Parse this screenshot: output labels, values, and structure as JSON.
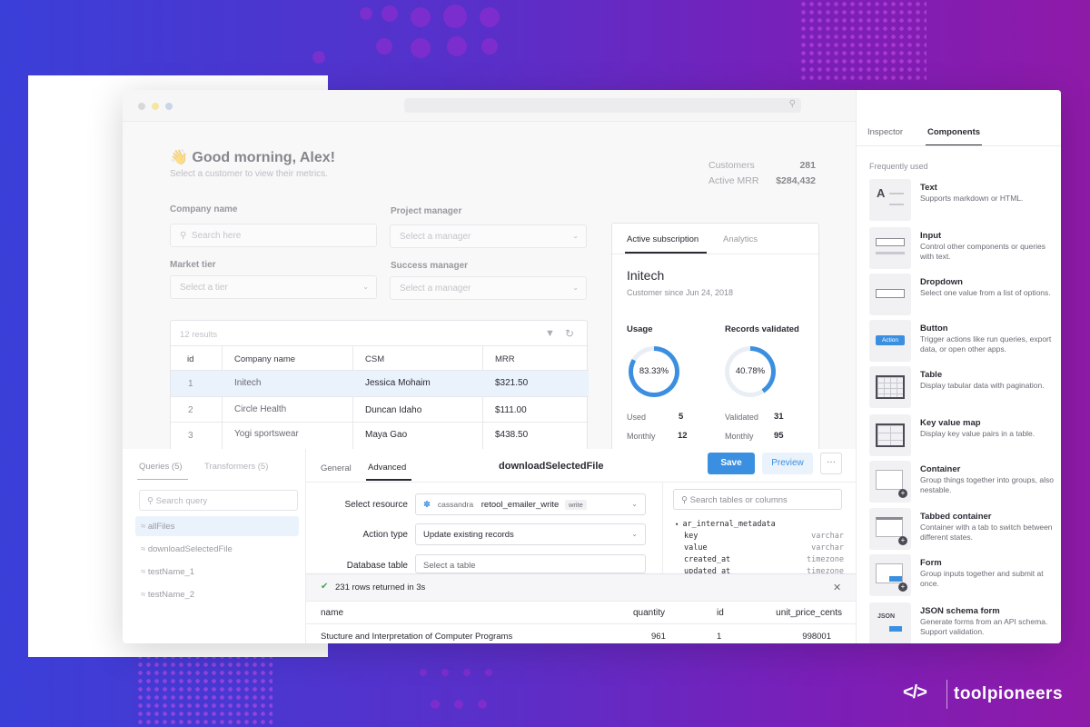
{
  "dashboard": {
    "greeting": "👋 Good morning, Alex!",
    "subtitle": "Select a customer to view their metrics.",
    "metrics": [
      {
        "label": "Customers",
        "value": "281"
      },
      {
        "label": "Active MRR",
        "value": "$284,432"
      }
    ],
    "filters": {
      "company_name_label": "Company name",
      "company_name_placeholder": "Search here",
      "project_manager_label": "Project manager",
      "project_manager_placeholder": "Select a manager",
      "market_tier_label": "Market tier",
      "market_tier_placeholder": "Select a tier",
      "success_manager_label": "Success manager",
      "success_manager_placeholder": "Select a manager"
    },
    "table": {
      "results": "12 results",
      "columns": [
        "id",
        "Company name",
        "CSM",
        "MRR"
      ],
      "rows": [
        {
          "id": "1",
          "company": "Initech",
          "csm": "Jessica Mohaim",
          "mrr": "$321.50"
        },
        {
          "id": "2",
          "company": "Circle Health",
          "csm": "Duncan Idaho",
          "mrr": "$111.00"
        },
        {
          "id": "3",
          "company": "Yogi sportswear",
          "csm": "Maya Gao",
          "mrr": "$438.50"
        }
      ]
    },
    "subscription": {
      "tabs": [
        "Active subscription",
        "Analytics"
      ],
      "company": "Initech",
      "since": "Customer since Jun 24, 2018",
      "usage_label": "Usage",
      "usage_pct": "83.33%",
      "usage_fraction": 0.8333,
      "records_label": "Records validated",
      "records_pct": "40.78%",
      "records_fraction": 0.4078,
      "used_label": "Used",
      "used_value": "5",
      "monthly_label": "Monthly",
      "monthly_value": "12",
      "validated_label": "Validated",
      "validated_value": "31",
      "monthly2_label": "Monthly",
      "monthly2_value": "95"
    }
  },
  "inspector": {
    "tabs": [
      "Inspector",
      "Components"
    ],
    "section": "Frequently used",
    "components": [
      {
        "title": "Text",
        "desc": "Supports markdown or HTML."
      },
      {
        "title": "Input",
        "desc": "Control other components or queries with text."
      },
      {
        "title": "Dropdown",
        "desc": "Select one value from a list of options."
      },
      {
        "title": "Button",
        "desc": "Trigger actions like run queries, export data, or open other apps."
      },
      {
        "title": "Table",
        "desc": "Display tabular data with pagination."
      },
      {
        "title": "Key value map",
        "desc": "Display key value pairs in a table."
      },
      {
        "title": "Container",
        "desc": "Group things together into groups, also nestable."
      },
      {
        "title": "Tabbed container",
        "desc": "Container with a tab to switch between different states."
      },
      {
        "title": "Form",
        "desc": "Group inputs together and submit at once."
      },
      {
        "title": "JSON schema form",
        "desc": "Generate forms from an API schema. Support validation."
      }
    ],
    "thumb_labels": {
      "text": "A",
      "button": "Action",
      "json": "JSON"
    }
  },
  "queries": {
    "tabs": [
      "Queries (5)",
      "Transformers (5)"
    ],
    "search_placeholder": "Search query",
    "items": [
      "allFiles",
      "downloadSelectedFile",
      "testName_1",
      "testName_2"
    ]
  },
  "editor": {
    "tabs": [
      "General",
      "Advanced"
    ],
    "query_name": "downloadSelectedFile",
    "save": "Save",
    "preview": "Preview",
    "more": "···",
    "resource_label": "Select resource",
    "resource_type": "cassandra",
    "resource_name": "retool_emailer_write",
    "resource_badge": "write",
    "action_label": "Action type",
    "action_value": "Update existing records",
    "table_label": "Database table",
    "table_placeholder": "Select a table",
    "schema_search": "Search tables or columns",
    "schema_table": "ar_internal_metadata",
    "schema_columns": [
      {
        "name": "key",
        "type": "varchar"
      },
      {
        "name": "value",
        "type": "varchar"
      },
      {
        "name": "created_at",
        "type": "timezone"
      },
      {
        "name": "updated_at",
        "type": "timezone"
      }
    ],
    "result_status": "231 rows returned in 3s",
    "result_columns": [
      "name",
      "quantity",
      "id",
      "unit_price_cents"
    ],
    "result_row": {
      "name": "Stucture and Interpretation of Computer Programs",
      "quantity": "961",
      "id": "1",
      "unit_price_cents": "998001"
    }
  },
  "brand": {
    "name": "toolpioneers",
    "logo": "</>"
  },
  "colors": {
    "accent": "#3b8fe0",
    "ring_track": "#e9eef5",
    "bg_start": "#3a3fd8",
    "bg_end": "#8f1aa8"
  }
}
